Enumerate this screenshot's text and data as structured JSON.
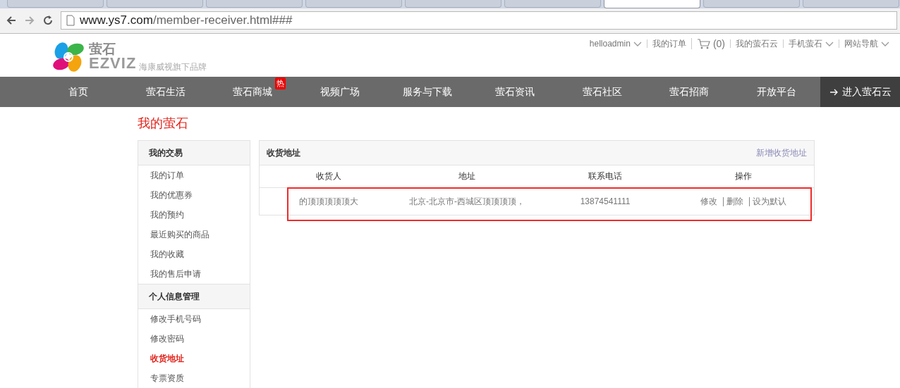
{
  "browser": {
    "tabs": [
      {
        "selected": false
      },
      {
        "selected": false
      },
      {
        "selected": false
      },
      {
        "selected": false
      },
      {
        "selected": false
      },
      {
        "selected": false
      },
      {
        "selected": true
      },
      {
        "selected": false
      },
      {
        "selected": false
      }
    ],
    "url_host": "www.ys7.com",
    "url_path": "/member-receiver.html###"
  },
  "header": {
    "logo_name": "萤石",
    "logo_brand": "EZVIZ",
    "tagline": "海康威视旗下品牌",
    "top_links": [
      {
        "kind": "dropdown",
        "label": "helloadmin"
      },
      {
        "kind": "link",
        "label": "我的订单"
      },
      {
        "kind": "cart",
        "label": "(0)"
      },
      {
        "kind": "link",
        "label": "我的萤石云"
      },
      {
        "kind": "dropdown",
        "label": "手机萤石"
      },
      {
        "kind": "dropdown",
        "label": "网站导航"
      }
    ]
  },
  "nav": {
    "items": [
      {
        "label": "首页"
      },
      {
        "label": "萤石生活"
      },
      {
        "label": "萤石商城",
        "badge": "热"
      },
      {
        "label": "视频广场"
      },
      {
        "label": "服务与下载"
      },
      {
        "label": "萤石资讯"
      },
      {
        "label": "萤石社区"
      },
      {
        "label": "萤石招商"
      },
      {
        "label": "开放平台"
      }
    ],
    "cta": "进入萤石云"
  },
  "page_title": "我的萤石",
  "sidebar": {
    "groups": [
      {
        "title": "我的交易",
        "items": [
          {
            "label": "我的订单",
            "selected": false
          },
          {
            "label": "我的优惠券",
            "selected": false
          },
          {
            "label": "我的预约",
            "selected": false
          },
          {
            "label": "最近购买的商品",
            "selected": false
          },
          {
            "label": "我的收藏",
            "selected": false
          },
          {
            "label": "我的售后申请",
            "selected": false
          }
        ]
      },
      {
        "title": "个人信息管理",
        "items": [
          {
            "label": "修改手机号码",
            "selected": false
          },
          {
            "label": "修改密码",
            "selected": false
          },
          {
            "label": "收货地址",
            "selected": true
          },
          {
            "label": "专票资质",
            "selected": false
          }
        ]
      }
    ]
  },
  "panel": {
    "title": "收货地址",
    "add_link": "新增收货地址",
    "table": {
      "columns": [
        "收货人",
        "地址",
        "联系电话",
        "操作"
      ],
      "rows": [
        {
          "highlighted": true,
          "name": "的顶顶顶顶顶大",
          "address": "北京-北京市-西城区顶顶顶顶，",
          "phone": "13874541111",
          "actions": [
            "修改",
            "删除",
            "设为默认"
          ]
        }
      ]
    }
  }
}
